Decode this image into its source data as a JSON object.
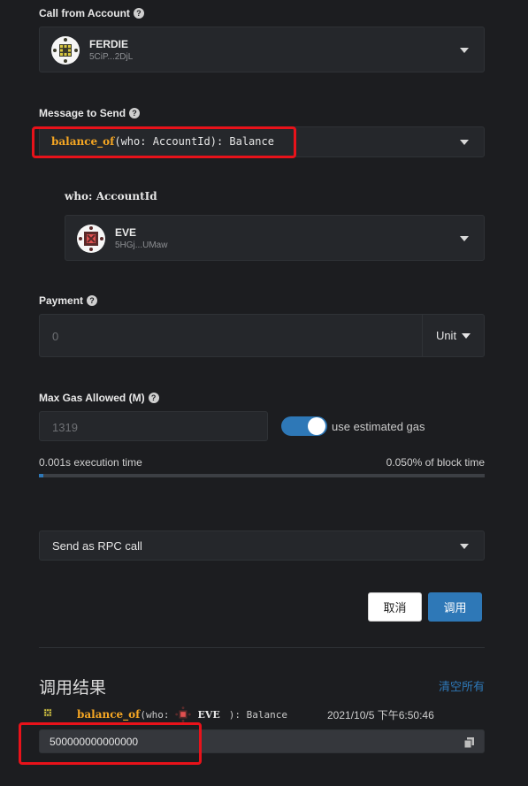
{
  "call_from": {
    "label": "Call from Account",
    "account": {
      "name": "FERDIE",
      "address": "5CiP...2DjL",
      "identicon": "ferdie-identicon"
    }
  },
  "message": {
    "label": "Message to Send",
    "method": "balance_of",
    "params": "(who: AccountId): Balance"
  },
  "param_who": {
    "name": "who:",
    "type": "AccountId",
    "account": {
      "name": "EVE",
      "address": "5HGj...UMaw",
      "identicon": "eve-identicon"
    }
  },
  "payment": {
    "label": "Payment",
    "placeholder": "0",
    "unit": "Unit"
  },
  "gas": {
    "label": "Max Gas Allowed (M)",
    "placeholder": "1319",
    "toggle_label": "use estimated gas",
    "toggle_on": true,
    "exec_time": "0.001s execution time",
    "block_time": "0.050% of block time",
    "block_fraction": 0.0005
  },
  "send_mode": {
    "selected": "Send as RPC call"
  },
  "actions": {
    "cancel": "取消",
    "call": "调用"
  },
  "results": {
    "title": "调用结果",
    "clear_all": "清空所有",
    "entry": {
      "method": "balance_of",
      "open": "(who:",
      "account": "EVE",
      "close": "): Balance",
      "timestamp": "2021/10/5 下午6:50:46",
      "value": "500000000000000"
    }
  },
  "colors": {
    "accent": "#2e78b7",
    "highlight_box": "#e8121a",
    "method_color": "#f5a623"
  }
}
